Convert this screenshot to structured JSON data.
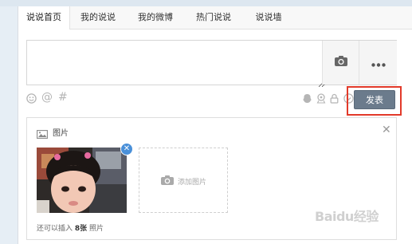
{
  "tabs": [
    {
      "label": "说说首页",
      "active": true
    },
    {
      "label": "我的说说",
      "active": false
    },
    {
      "label": "我的微博",
      "active": false
    },
    {
      "label": "热门说说",
      "active": false
    },
    {
      "label": "说说墙",
      "active": false
    }
  ],
  "toolbar": {
    "left_icons": [
      "smiley-icon",
      "at-icon",
      "hash-icon"
    ],
    "right_icons": [
      "qzone-icon",
      "location-icon",
      "lock-icon",
      "chevron-down-icon"
    ],
    "publish_label": "发表"
  },
  "photos": {
    "section_label": "图片",
    "add_label": "添加图片",
    "remaining_prefix": "还可以插入",
    "remaining_count": "8张",
    "remaining_suffix": "照片"
  },
  "watermark": "Baidu经验",
  "colors": {
    "publish_button": "#6b7b8c",
    "highlight": "#e23a2a",
    "remove_badge": "#4a90d9"
  }
}
